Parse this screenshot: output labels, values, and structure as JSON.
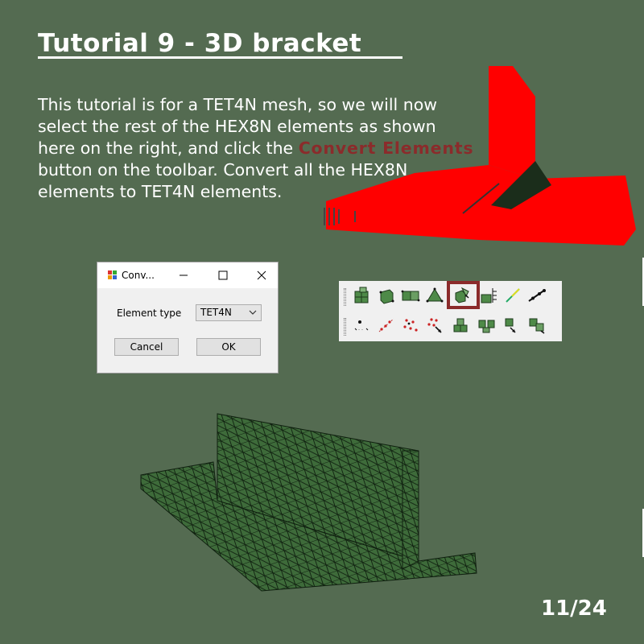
{
  "slide": {
    "title": "Tutorial 9 - 3D bracket  ",
    "body_before": "This tutorial is for a TET4N mesh, so we will now select the rest of the HEX8N elements as shown here on the right, and click the ",
    "body_highlight": "Convert Elements",
    "body_after": " button on the toolbar. Convert all the HEX8N elements to TET4N elements.",
    "page_number": "11/24",
    "colors": {
      "background": "#546b51",
      "highlight": "#8b2b2b",
      "selected_mesh": "#ff0000",
      "mesh": "#3e6b3a"
    }
  },
  "dialog": {
    "title": "Conv...",
    "element_type_label": "Element type",
    "element_type_value": "TET4N",
    "cancel_label": "Cancel",
    "ok_label": "OK",
    "icons": [
      "app-icon",
      "minimize-icon",
      "maximize-icon",
      "close-icon",
      "chevron-down-icon"
    ]
  },
  "toolbar": {
    "row1": [
      "mesh-quad-icon",
      "hex-element-icon",
      "hex-pair-icon",
      "tet-element-icon",
      "convert-elements-icon",
      "element-list-icon",
      "line-element-icon",
      "beam-element-icon"
    ],
    "row2": [
      "node-label-icon",
      "nodes-along-line-icon",
      "node-cloud-icon",
      "nodes-arrow-icon",
      "assemble-icon",
      "split-icon",
      "rotate-icon",
      "mirror-icon"
    ],
    "highlighted": "convert-elements-icon"
  }
}
